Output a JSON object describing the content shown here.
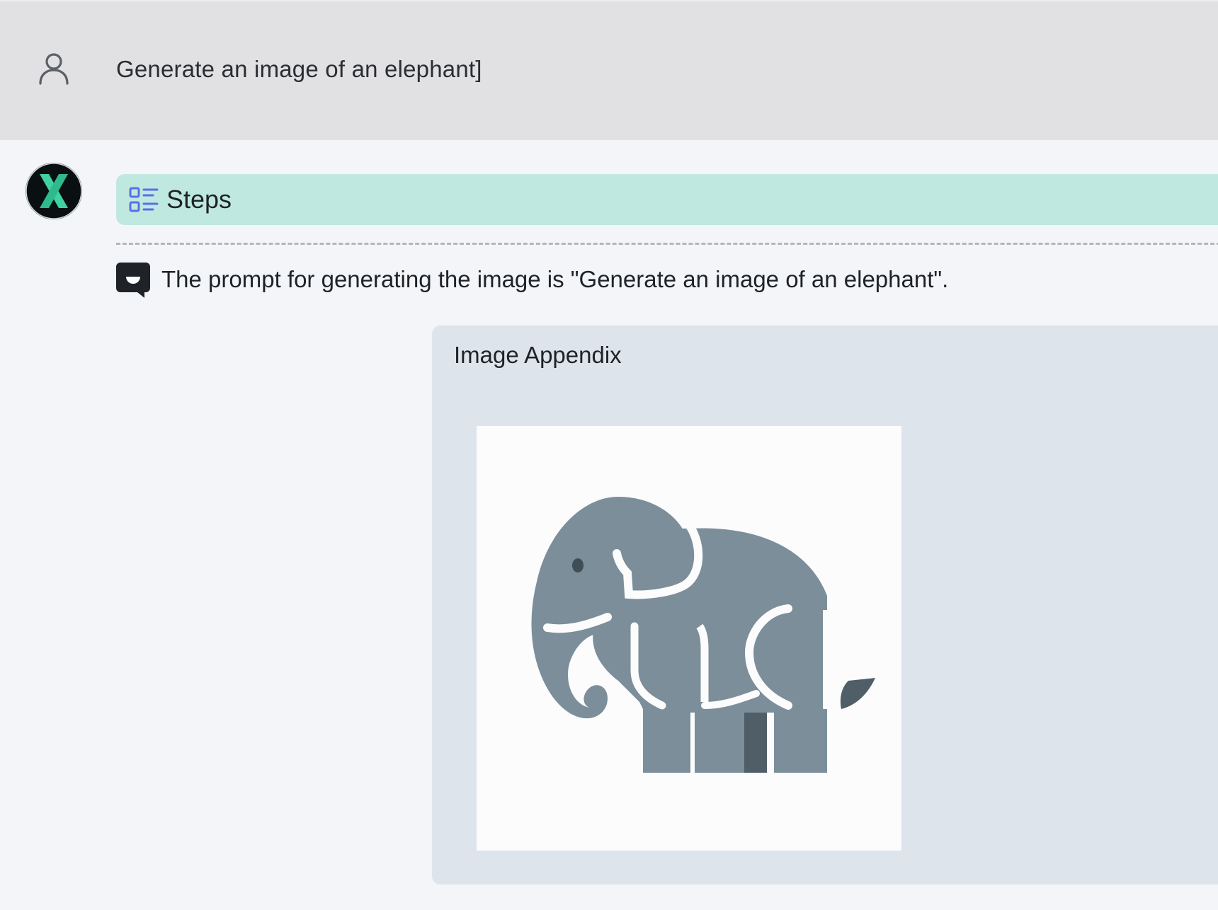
{
  "user_message": {
    "text": "Generate an image of an elephant]",
    "avatar_icon": "user-icon"
  },
  "assistant": {
    "avatar_icon": "x-logo-icon",
    "avatar_colors": {
      "background": "#0a0f12",
      "accent": "#3fd1a1"
    },
    "steps": {
      "label": "Steps",
      "icon": "steps-list-icon",
      "background": "#bfe9e0",
      "icon_color": "#5a6ee8"
    },
    "prompt_line": {
      "icon": "chat-bubble-icon",
      "text": "The prompt for generating the image is \"Generate an image of an elephant\"."
    },
    "image_appendix": {
      "title": "Image Appendix",
      "image_subject": "elephant-illustration",
      "image_colors": {
        "body": "#7b8e9a",
        "shadow": "#4f5e67",
        "background": "#fcfcfc"
      }
    }
  }
}
